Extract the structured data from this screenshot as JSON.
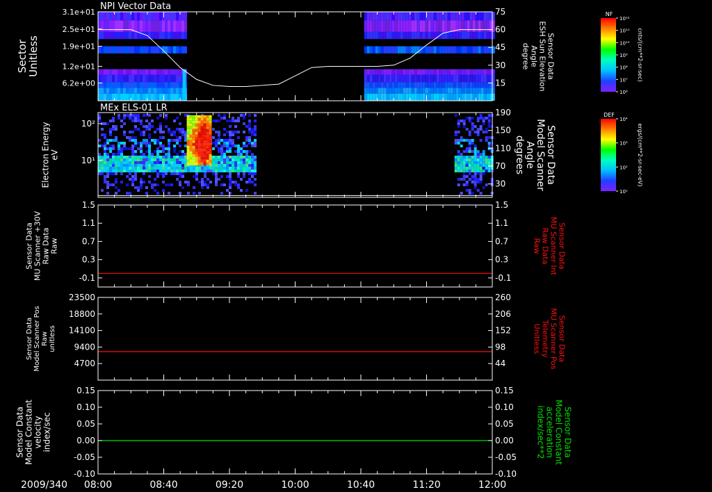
{
  "time_axis": {
    "date": "2009/340",
    "ticks": [
      "08:00",
      "08:40",
      "09:20",
      "10:00",
      "10:40",
      "11:20",
      "12:00"
    ]
  },
  "colors": {
    "background": "#000000",
    "axis": "#ffffff",
    "red_trace": "#ff1010",
    "green_trace": "#00e000",
    "spectrogram_cyan": "#00c8ff",
    "spectrogram_blue": "#2020ff",
    "spectrogram_purple": "#8020ff",
    "spectrogram_red": "#ff2000"
  },
  "chart_data": [
    {
      "type": "heatmap",
      "title": "NPI Vector Data",
      "ylabel_lines": [
        "Sector",
        "Unitless"
      ],
      "y_ticks": [
        "3.1e+01",
        "2.5e+01",
        "1.9e+01",
        "1.2e+01",
        "6.2e+00"
      ],
      "y_tick_values": [
        31,
        25,
        19,
        12,
        6.2
      ],
      "ylim": [
        0,
        31
      ],
      "data_intervals": [
        [
          "08:00",
          "08:54"
        ],
        [
          "10:42",
          "12:00"
        ]
      ],
      "overlay": {
        "type": "line",
        "y2label_lines": [
          "Sensor Data",
          "ESH Sun Elevation",
          "Angle",
          "degree"
        ],
        "y2_ticks": [
          "75",
          "60",
          "45",
          "30",
          "15"
        ],
        "y2lim": [
          0,
          75
        ],
        "x": [
          "08:00",
          "08:10",
          "08:20",
          "08:30",
          "08:40",
          "08:50",
          "09:00",
          "09:10",
          "09:20",
          "09:30",
          "09:40",
          "09:50",
          "10:00",
          "10:10",
          "10:20",
          "10:30",
          "10:40",
          "10:50",
          "11:00",
          "11:10",
          "11:20",
          "11:30",
          "11:40",
          "11:50",
          "12:00"
        ],
        "values": [
          60,
          60,
          60,
          55,
          42,
          28,
          18,
          13,
          12,
          12,
          13,
          14,
          21,
          28,
          29,
          29,
          29,
          29,
          30,
          36,
          47,
          57,
          60,
          60,
          60
        ]
      },
      "colorbar": {
        "label": "NF",
        "units": "cnts/(cm**2-sr-sec)",
        "ticks": [
          "10¹²",
          "10¹¹",
          "10¹⁰",
          "10⁹",
          "10⁸",
          "10⁷",
          "10⁶"
        ]
      }
    },
    {
      "type": "heatmap",
      "title": "MEx ELS-01 LR",
      "ylabel_lines": [
        "Electron Energy",
        "eV"
      ],
      "y_ticks": [
        "10²",
        "10¹"
      ],
      "y_scale": "log",
      "ylim": [
        1,
        200
      ],
      "data_intervals": [
        [
          "08:00",
          "09:36"
        ],
        [
          "11:37",
          "12:00"
        ]
      ],
      "peak": {
        "x_range": [
          "08:54",
          "09:09"
        ],
        "energy_range": [
          8,
          170
        ]
      },
      "overlay": {
        "type": "line",
        "y2label_lines": [
          "Sensor Data",
          "Model Scanner",
          "Angle",
          "degrees"
        ],
        "y2_ticks": [
          "190",
          "150",
          "110",
          "70",
          "30"
        ],
        "y2lim": [
          0,
          190
        ],
        "x": [
          "08:00",
          "12:00"
        ],
        "values": [
          4,
          4
        ]
      },
      "colorbar": {
        "label": "DEF",
        "units": "ergs/(cm**2-sr-sec-eV)",
        "ticks": [
          "10⁴",
          "10³",
          "10²",
          "10¹"
        ]
      }
    },
    {
      "type": "line",
      "ylabel_lines": [
        "Sensor Data",
        "MU Scanner +30V",
        "Raw Data",
        "Raw"
      ],
      "y_ticks": [
        "1.5",
        "1.1",
        "0.7",
        "0.3",
        "-0.1"
      ],
      "ylim": [
        -0.3,
        1.5
      ],
      "y2label_lines": [
        "Sensor Data",
        "MU Scanner Int",
        "Raw Data",
        "Raw"
      ],
      "y2_ticks": [
        "1.5",
        "1.1",
        "0.7",
        "0.3",
        "-0.1"
      ],
      "series": [
        {
          "color": "#ff1010",
          "x": [
            "08:00",
            "12:00"
          ],
          "values": [
            0.0,
            0.0
          ]
        }
      ]
    },
    {
      "type": "line",
      "ylabel_lines": [
        "Sensor Data",
        "Model Scanner Pos",
        "Raw",
        "unitless"
      ],
      "y_ticks": [
        "23500",
        "18800",
        "14100",
        "9400",
        "4700"
      ],
      "ylim": [
        0,
        23500
      ],
      "y2label_lines": [
        "Sensor Data",
        "MU Scanner Pos",
        "Telemetry",
        "Unitless"
      ],
      "y2_ticks": [
        "260",
        "206",
        "152",
        "98",
        "44"
      ],
      "series": [
        {
          "color": "#ff1010",
          "x": [
            "08:00",
            "12:00"
          ],
          "values": [
            8100,
            8100
          ]
        }
      ]
    },
    {
      "type": "line",
      "ylabel_lines": [
        "Sensor Data",
        "Model Constant",
        "velocity",
        "index/sec"
      ],
      "y_ticks": [
        "0.15",
        "0.10",
        "0.05",
        "0.00",
        "-0.05",
        "-0.10"
      ],
      "ylim": [
        -0.1,
        0.15
      ],
      "y2label_lines": [
        "Sensor Data",
        "Model Constant",
        "acceleration",
        "index/sec**2"
      ],
      "y2_ticks": [
        "0.15",
        "0.10",
        "0.05",
        "0.00",
        "-0.05",
        "-0.10"
      ],
      "series": [
        {
          "color": "#00e000",
          "x": [
            "08:00",
            "12:00"
          ],
          "values": [
            0.0,
            0.0
          ]
        }
      ]
    }
  ]
}
